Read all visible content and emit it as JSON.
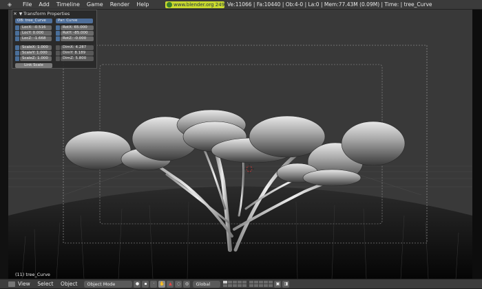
{
  "topbar": {
    "menu": [
      "File",
      "Add",
      "Timeline",
      "Game",
      "Render",
      "Help"
    ],
    "url": "www.blender.org 249.2",
    "stats": "Ve:11066 | Fa:10440 | Ob:4-0 | La:0  | Mem:77.43M (0.09M)  | Time: | tree_Curve"
  },
  "panel": {
    "title": "Transform Properties",
    "ob": "OB: tree_Curve",
    "par": "Par: Curve",
    "loc": [
      "LocX: -0.516",
      "LocY: 0.000",
      "LocZ: -1.668"
    ],
    "rot": [
      "RotX: 65.000",
      "RotY: -85.000",
      "RotZ: -0.000"
    ],
    "scale": [
      "ScaleX: 1.000",
      "ScaleY: 1.000",
      "ScaleZ: 1.000"
    ],
    "dim": [
      "DimX: 4.287",
      "DimY: 8.189",
      "DimZ: 5.800"
    ],
    "link_scale": "Link Scale"
  },
  "status": "(11) tree_Curve",
  "bottombar": {
    "menu": [
      "View",
      "Select",
      "Object"
    ],
    "mode": "Object Mode",
    "orientation": "Global"
  },
  "icons": [
    "blender-logo-icon",
    "globe-icon",
    "close-icon",
    "collapse-triangle-icon",
    "lock-icon",
    "view-menu-icon",
    "hand-icon",
    "camera-icon"
  ],
  "colors": {
    "url_bg": "#c9d92e",
    "lock_blue": "#4a6f9a",
    "viewport_bg": "#393939"
  }
}
